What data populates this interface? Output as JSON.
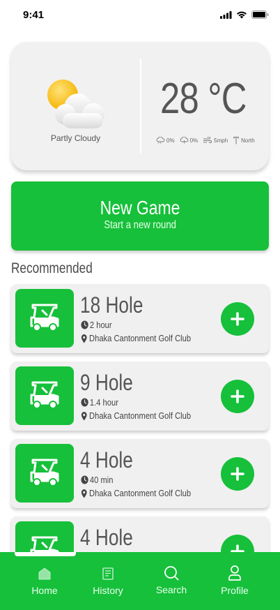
{
  "status_bar": {
    "time": "9:41"
  },
  "weather": {
    "condition": "Partly Cloudy",
    "temperature": "28 °C",
    "precipitation": "0%",
    "rain": "0%",
    "wind": "5mph",
    "direction": "North"
  },
  "new_game": {
    "title": "New Game",
    "subtitle": "Start a new round"
  },
  "section_title": "Recommended",
  "courses": [
    {
      "name": "18 Hole",
      "duration": "2 hour",
      "club": "Dhaka Cantonment Golf Club"
    },
    {
      "name": "9 Hole",
      "duration": "1.4 hour",
      "club": "Dhaka Cantonment Golf Club"
    },
    {
      "name": "4 Hole",
      "duration": "40 min",
      "club": "Dhaka Cantonment Golf Club"
    },
    {
      "name": "4 Hole",
      "duration": "",
      "club": ""
    }
  ],
  "nav": {
    "items": [
      {
        "label": "Home",
        "icon": "home-icon"
      },
      {
        "label": "History",
        "icon": "history-icon"
      },
      {
        "label": "Search",
        "icon": "search-icon"
      },
      {
        "label": "Profile",
        "icon": "profile-icon"
      }
    ],
    "active": "Home"
  },
  "colors": {
    "accent": "#16c03a",
    "card": "#f0f0f0",
    "text": "#555555"
  }
}
